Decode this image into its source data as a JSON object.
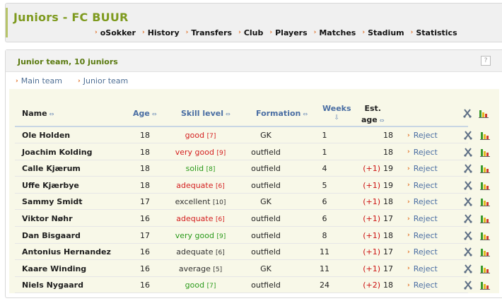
{
  "header": {
    "title": "Juniors - FC BUUR",
    "nav": [
      "oSokker",
      "History",
      "Transfers",
      "Club",
      "Players",
      "Matches",
      "Stadium",
      "Statistics"
    ]
  },
  "panel": {
    "title": "Junior team, 10 juniors",
    "help": "?",
    "subnav": [
      "Main team",
      "Junior team"
    ]
  },
  "table": {
    "headers": {
      "name": "Name",
      "age": "Age",
      "skill": "Skill level",
      "formation": "Formation",
      "weeks": "Weeks",
      "est_line1": "Est.",
      "est_line2": "age"
    },
    "reject_label": "Reject",
    "colors": {
      "good": "#d42020",
      "green": "#2a9a1a",
      "neutral": "#333333",
      "bonus": "#cc1111",
      "link": "#4a6ea3",
      "title": "#7e9a1e"
    },
    "rows": [
      {
        "name": "Ole Holden",
        "age": "18",
        "skill": "good",
        "level": "[7]",
        "skill_color": "#d42020",
        "formation": "GK",
        "weeks": "1",
        "bonus": "",
        "est_age": "18"
      },
      {
        "name": "Joachim Kolding",
        "age": "18",
        "skill": "very good",
        "level": "[9]",
        "skill_color": "#d42020",
        "formation": "outfield",
        "weeks": "1",
        "bonus": "",
        "est_age": "18"
      },
      {
        "name": "Calle Kjærum",
        "age": "18",
        "skill": "solid",
        "level": "[8]",
        "skill_color": "#2a9a1a",
        "formation": "outfield",
        "weeks": "4",
        "bonus": "(+1)",
        "est_age": "19"
      },
      {
        "name": "Uffe Kjærbye",
        "age": "18",
        "skill": "adequate",
        "level": "[6]",
        "skill_color": "#d42020",
        "formation": "outfield",
        "weeks": "5",
        "bonus": "(+1)",
        "est_age": "19"
      },
      {
        "name": "Sammy Smidt",
        "age": "17",
        "skill": "excellent",
        "level": "[10]",
        "skill_color": "#333333",
        "formation": "GK",
        "weeks": "6",
        "bonus": "(+1)",
        "est_age": "18"
      },
      {
        "name": "Viktor Nøhr",
        "age": "16",
        "skill": "adequate",
        "level": "[6]",
        "skill_color": "#d42020",
        "formation": "outfield",
        "weeks": "6",
        "bonus": "(+1)",
        "est_age": "17"
      },
      {
        "name": "Dan Bisgaard",
        "age": "17",
        "skill": "very good",
        "level": "[9]",
        "skill_color": "#2a9a1a",
        "formation": "outfield",
        "weeks": "8",
        "bonus": "(+1)",
        "est_age": "18"
      },
      {
        "name": "Antonius Hernandez",
        "age": "16",
        "skill": "adequate",
        "level": "[6]",
        "skill_color": "#333333",
        "formation": "outfield",
        "weeks": "11",
        "bonus": "(+1)",
        "est_age": "17"
      },
      {
        "name": "Kaare Winding",
        "age": "16",
        "skill": "average",
        "level": "[5]",
        "skill_color": "#333333",
        "formation": "GK",
        "weeks": "11",
        "bonus": "(+1)",
        "est_age": "17"
      },
      {
        "name": "Niels Nygaard",
        "age": "16",
        "skill": "good",
        "level": "[7]",
        "skill_color": "#2a9a1a",
        "formation": "outfield",
        "weeks": "24",
        "bonus": "(+2)",
        "est_age": "18"
      }
    ]
  }
}
